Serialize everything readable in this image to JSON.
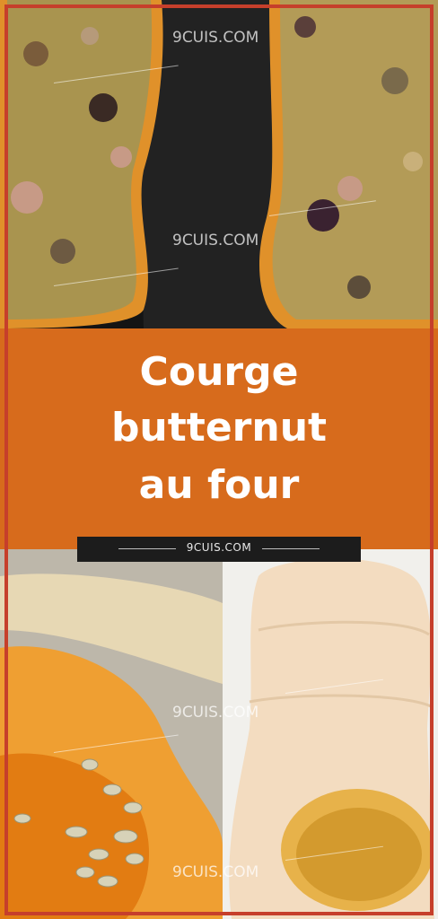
{
  "title": {
    "line1": "Courge",
    "line2": "butternut",
    "line3": "au four"
  },
  "site_bar": {
    "label": "9CUIS.COM"
  },
  "watermarks": [
    "9CUIS.COM",
    "9CUIS.COM",
    "9CUIS.COM",
    "9CUIS.COM"
  ],
  "colors": {
    "band": "#d76b1c",
    "frame": "#c63f2b",
    "bar": "#1c1c1c",
    "text": "#ffffff"
  }
}
